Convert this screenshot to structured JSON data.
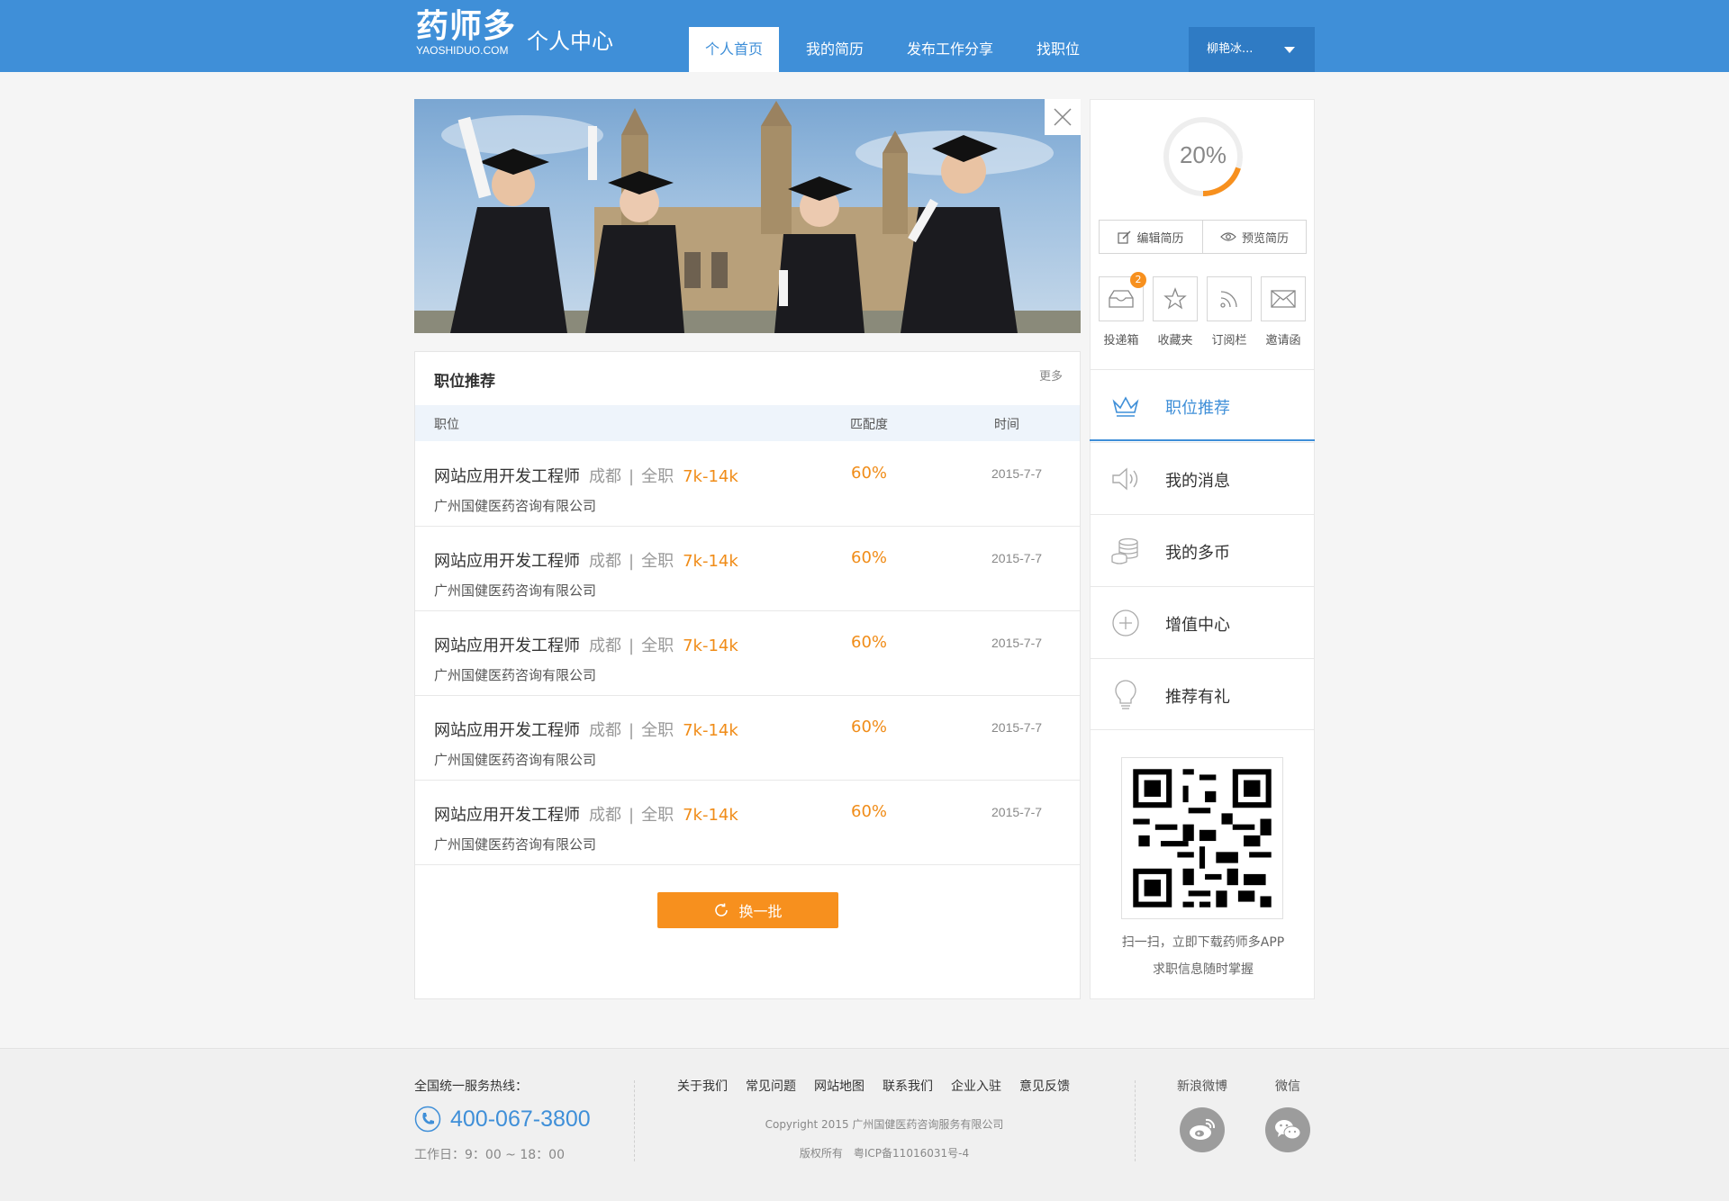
{
  "header": {
    "logo_text": "药师多",
    "logo_sub": "YAOSHIDUO.COM",
    "page_title": "个人中心",
    "nav": [
      {
        "label": "个人首页",
        "active": true
      },
      {
        "label": "我的简历",
        "active": false
      },
      {
        "label": "发布工作分享",
        "active": false
      },
      {
        "label": "找职位",
        "active": false
      }
    ],
    "user_name": "柳艳冰..."
  },
  "jobs": {
    "title": "职位推荐",
    "more_label": "更多",
    "columns": {
      "position": "职位",
      "match": "匹配度",
      "time": "时间"
    },
    "rows": [
      {
        "title": "网站应用开发工程师",
        "city": "成都",
        "separator": "|",
        "type": "全职",
        "salary": "7k-14k",
        "company": "广州国健医药咨询有限公司",
        "match": "60%",
        "date": "2015-7-7"
      },
      {
        "title": "网站应用开发工程师",
        "city": "成都",
        "separator": "|",
        "type": "全职",
        "salary": "7k-14k",
        "company": "广州国健医药咨询有限公司",
        "match": "60%",
        "date": "2015-7-7"
      },
      {
        "title": "网站应用开发工程师",
        "city": "成都",
        "separator": "|",
        "type": "全职",
        "salary": "7k-14k",
        "company": "广州国健医药咨询有限公司",
        "match": "60%",
        "date": "2015-7-7"
      },
      {
        "title": "网站应用开发工程师",
        "city": "成都",
        "separator": "|",
        "type": "全职",
        "salary": "7k-14k",
        "company": "广州国健医药咨询有限公司",
        "match": "60%",
        "date": "2015-7-7"
      },
      {
        "title": "网站应用开发工程师",
        "city": "成都",
        "separator": "|",
        "type": "全职",
        "salary": "7k-14k",
        "company": "广州国健医药咨询有限公司",
        "match": "60%",
        "date": "2015-7-7"
      }
    ],
    "refresh_label": "换一批"
  },
  "sidebar": {
    "completion_percent": 20,
    "completion_label": "20%",
    "edit_resume": "编辑简历",
    "preview_resume": "预览简历",
    "quick": [
      {
        "label": "投递箱",
        "icon": "inbox-icon",
        "badge": "2"
      },
      {
        "label": "收藏夹",
        "icon": "star-icon"
      },
      {
        "label": "订阅栏",
        "icon": "rss-icon"
      },
      {
        "label": "邀请函",
        "icon": "mail-icon"
      }
    ],
    "menu": [
      {
        "label": "职位推荐",
        "icon": "crown-icon",
        "active": true
      },
      {
        "label": "我的消息",
        "icon": "speaker-icon"
      },
      {
        "label": "我的多币",
        "icon": "coins-icon"
      },
      {
        "label": "增值中心",
        "icon": "plus-circle-icon"
      },
      {
        "label": "推荐有礼",
        "icon": "lightbulb-icon"
      }
    ],
    "qr_line1": "扫一扫，立即下载药师多APP",
    "qr_line2": "求职信息随时掌握"
  },
  "footer": {
    "hotline_label": "全国统一服务热线：",
    "hotline": "400-067-3800",
    "work_hours": "工作日：9：00 ~ 18：00",
    "links": [
      "关于我们",
      "常见问题",
      "网站地图",
      "联系我们",
      "企业入驻",
      "意见反馈"
    ],
    "copyright": "Copyright 2015 广州国健医药咨询服务有限公司",
    "icp": "版权所有　粤ICP备11016031号-4",
    "weibo_label": "新浪微博",
    "wechat_label": "微信"
  },
  "colors": {
    "brand_blue": "#3f8fd8",
    "accent_orange": "#f7901e"
  }
}
